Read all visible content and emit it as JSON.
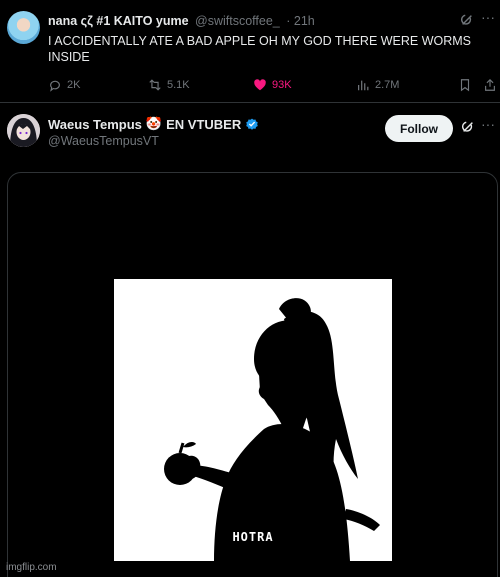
{
  "tweet1": {
    "display_name": "nana ςζ #1 KAITO yume",
    "handle": "@swiftscoffee_",
    "time": "· 21h",
    "text": "I ACCIDENTALLY ATE A BAD APPLE OH MY GOD THERE WERE WORMS INSIDE",
    "replies": "2K",
    "reposts": "5.1K",
    "likes": "93K",
    "views": "2.7M",
    "more": "···",
    "like_color": "#f91880"
  },
  "tweet2": {
    "display_name": "Waeus Tempus",
    "emoji": "🤡",
    "name_suffix": "EN VTUBER",
    "handle": "@WaeusTempusVT",
    "follow_label": "Follow",
    "more": "···",
    "verified_color": "#1d9bf0",
    "image_caption": "HOTRA"
  },
  "watermark": "imgflip.com"
}
